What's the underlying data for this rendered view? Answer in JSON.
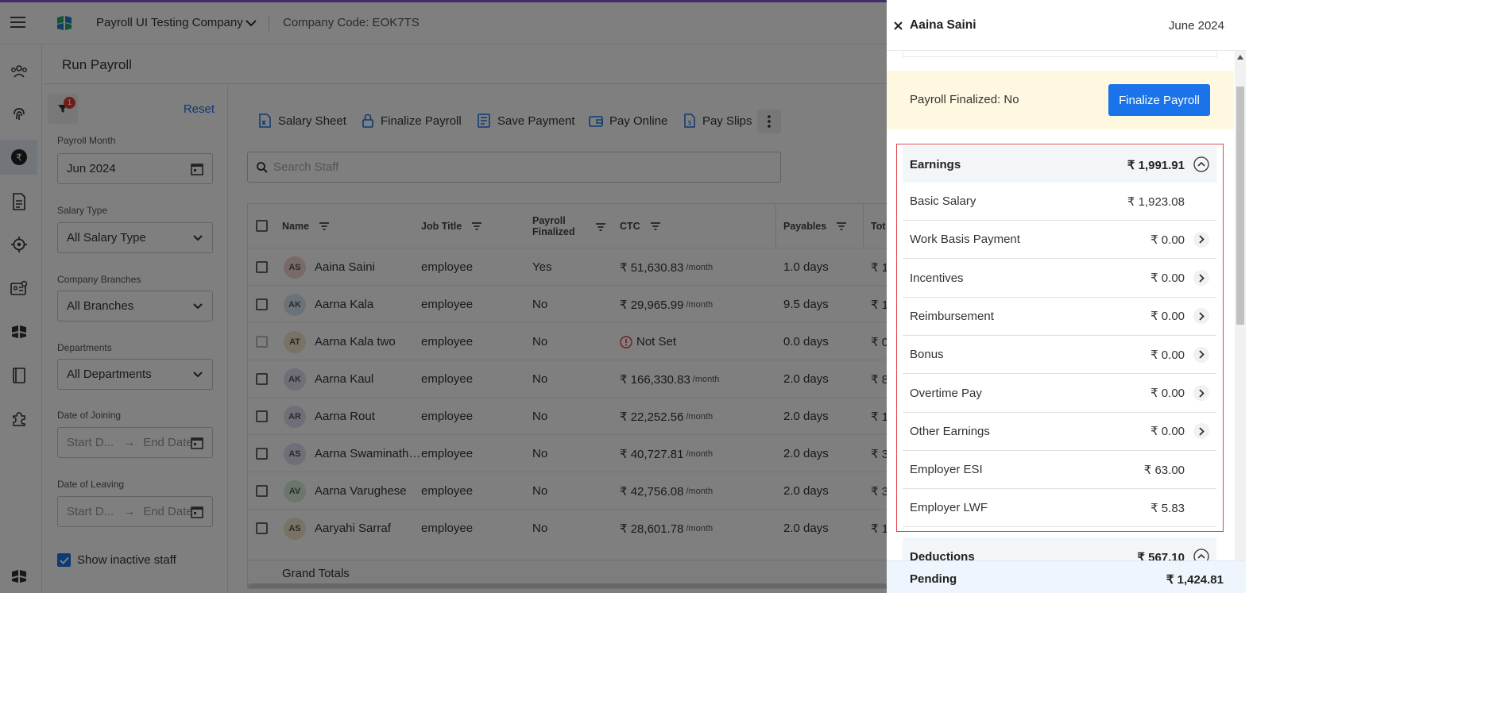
{
  "topbar": {
    "company_name": "Payroll UI Testing Company",
    "company_code": "Company Code: EOK7TS"
  },
  "subhead": {
    "title": "Run Payroll"
  },
  "filters": {
    "badge_count": "1",
    "reset_label": "Reset",
    "payroll_month_label": "Payroll Month",
    "payroll_month_value": "Jun 2024",
    "salary_type_label": "Salary Type",
    "salary_type_value": "All Salary Type",
    "branches_label": "Company Branches",
    "branches_value": "All Branches",
    "departments_label": "Departments",
    "departments_value": "All Departments",
    "joining_label": "Date of Joining",
    "leaving_label": "Date of Leaving",
    "start_placeholder": "Start D...",
    "end_placeholder": "End Date",
    "arrow": "→",
    "inactive_label": "Show inactive staff",
    "inactive_checked": true
  },
  "toolbar": {
    "salary_sheet": "Salary Sheet",
    "finalize_payroll": "Finalize Payroll",
    "save_payment": "Save Payment",
    "pay_online": "Pay Online",
    "pay_slips": "Pay Slips"
  },
  "search": {
    "placeholder": "Search Staff"
  },
  "table": {
    "headers": {
      "name": "Name",
      "job_title": "Job Title",
      "payroll_finalized_1": "Payroll",
      "payroll_finalized_2": "Finalized",
      "ctc": "CTC",
      "payables": "Payables",
      "total": "Tot"
    },
    "rows": [
      {
        "initials": "AS",
        "avatar_color": "#f3d2d2",
        "name": "Aaina Saini",
        "job": "employee",
        "finalized": "Yes",
        "ctc": "₹ 51,630.83",
        "per": "/month",
        "payables": "1.0 days",
        "total": "₹ 1"
      },
      {
        "initials": "AK",
        "avatar_color": "#d6e6f5",
        "name": "Aarna Kala",
        "job": "employee",
        "finalized": "No",
        "ctc": "₹ 29,965.99",
        "per": "/month",
        "payables": "9.5 days",
        "total": "₹ 1"
      },
      {
        "initials": "AT",
        "avatar_color": "#f1e6c9",
        "name": "Aarna Kala two",
        "job": "employee",
        "finalized": "No",
        "ctc": "Not Set",
        "per": "",
        "payables": "0.0 days",
        "total": "₹ 0"
      },
      {
        "initials": "AK",
        "avatar_color": "#e0dcf3",
        "name": "Aarna Kaul",
        "job": "employee",
        "finalized": "No",
        "ctc": "₹ 166,330.83",
        "per": "/month",
        "payables": "2.0 days",
        "total": "₹ 8"
      },
      {
        "initials": "AR",
        "avatar_color": "#e0dcf3",
        "name": "Aarna Rout",
        "job": "employee",
        "finalized": "No",
        "ctc": "₹ 22,252.56",
        "per": "/month",
        "payables": "2.0 days",
        "total": "₹ 1"
      },
      {
        "initials": "AS",
        "avatar_color": "#e0dcf3",
        "name": "Aarna Swaminath…",
        "job": "employee",
        "finalized": "No",
        "ctc": "₹ 40,727.81",
        "per": "/month",
        "payables": "2.0 days",
        "total": "₹ 3"
      },
      {
        "initials": "AV",
        "avatar_color": "#d8eed8",
        "name": "Aarna Varughese",
        "job": "employee",
        "finalized": "No",
        "ctc": "₹ 42,756.08",
        "per": "/month",
        "payables": "2.0 days",
        "total": "₹ 3"
      },
      {
        "initials": "AS",
        "avatar_color": "#f1e6c9",
        "name": "Aaryahi Sarraf",
        "job": "employee",
        "finalized": "No",
        "ctc": "₹ 28,601.78",
        "per": "/month",
        "payables": "2.0 days",
        "total": "₹ 1"
      }
    ],
    "grand_totals": "Grand Totals"
  },
  "panel": {
    "employee_name": "Aaina Saini",
    "month": "June 2024",
    "finalized_status": "Payroll Finalized: No",
    "finalize_button": "Finalize Payroll",
    "earnings_title": "Earnings",
    "earnings_total": "₹ 1,991.91",
    "earnings": [
      {
        "label": "Basic Salary",
        "amount": "₹ 1,923.08",
        "expandable": false
      },
      {
        "label": "Work Basis Payment",
        "amount": "₹ 0.00",
        "expandable": true
      },
      {
        "label": "Incentives",
        "amount": "₹ 0.00",
        "expandable": true
      },
      {
        "label": "Reimbursement",
        "amount": "₹ 0.00",
        "expandable": true
      },
      {
        "label": "Bonus",
        "amount": "₹ 0.00",
        "expandable": true
      },
      {
        "label": "Overtime Pay",
        "amount": "₹ 0.00",
        "expandable": true
      },
      {
        "label": "Other Earnings",
        "amount": "₹ 0.00",
        "expandable": true
      },
      {
        "label": "Employer ESI",
        "amount": "₹ 63.00",
        "expandable": false
      },
      {
        "label": "Employer LWF",
        "amount": "₹ 5.83",
        "expandable": false
      }
    ],
    "deductions_title": "Deductions",
    "deductions_total": "₹ 567.10",
    "pending_label": "Pending",
    "pending_amount": "₹ 1,424.81"
  },
  "colors": {
    "accent": "#1a73e8",
    "brand_purple": "#8a5cd0",
    "highlight_border": "#e0454d",
    "finalized_bg": "#fff8e1",
    "pending_bg": "#eef5fc"
  }
}
